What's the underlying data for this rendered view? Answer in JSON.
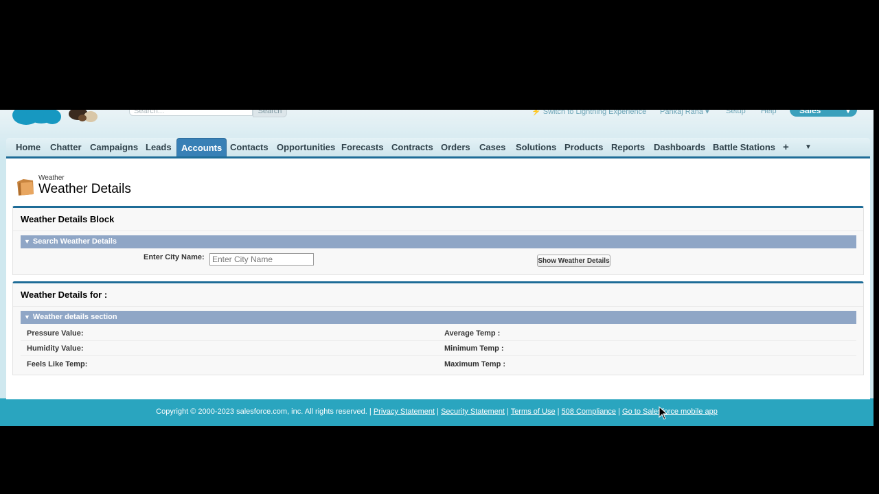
{
  "header": {
    "search_placeholder": "Search...",
    "search_button": "Search",
    "lightning_link": "Switch to Lightning Experience",
    "user_menu": "Pankaj Rana",
    "setup_link": "Setup",
    "help_link": "Help",
    "app_switcher": "Sales"
  },
  "tabs": [
    {
      "label": "Home"
    },
    {
      "label": "Chatter"
    },
    {
      "label": "Campaigns"
    },
    {
      "label": "Leads"
    },
    {
      "label": "Accounts",
      "active": true
    },
    {
      "label": "Contacts"
    },
    {
      "label": "Opportunities"
    },
    {
      "label": "Forecasts"
    },
    {
      "label": "Contracts"
    },
    {
      "label": "Orders"
    },
    {
      "label": "Cases"
    },
    {
      "label": "Solutions"
    },
    {
      "label": "Products"
    },
    {
      "label": "Reports"
    },
    {
      "label": "Dashboards"
    },
    {
      "label": "Battle Stations"
    },
    {
      "label": "+"
    }
  ],
  "page": {
    "breadcrumb": "Weather",
    "title": "Weather Details"
  },
  "search_block": {
    "title": "Weather Details Block",
    "section": "Search Weather Details",
    "city_label": "Enter City Name:",
    "city_placeholder": "Enter City Name",
    "button": "Show Weather Details"
  },
  "details_block": {
    "title": "Weather Details for :",
    "section": "Weather details section",
    "left_fields": [
      "Pressure Value:",
      "Humidity Value:",
      "Feels Like Temp:"
    ],
    "right_fields": [
      "Average Temp :",
      "Minimum Temp :",
      "Maximum Temp :"
    ]
  },
  "footer": {
    "copyright": "Copyright © 2000-2023 salesforce.com, inc. All rights reserved. |",
    "links": [
      "Privacy Statement",
      "Security Statement",
      "Terms of Use",
      "508 Compliance",
      "Go to Salesforce mobile app"
    ]
  },
  "colors": {
    "tab_active": "#3880b6",
    "section_header": "#8fa6c6",
    "block_border": "#1e6c97",
    "footer_bg": "#2aa5bf"
  }
}
